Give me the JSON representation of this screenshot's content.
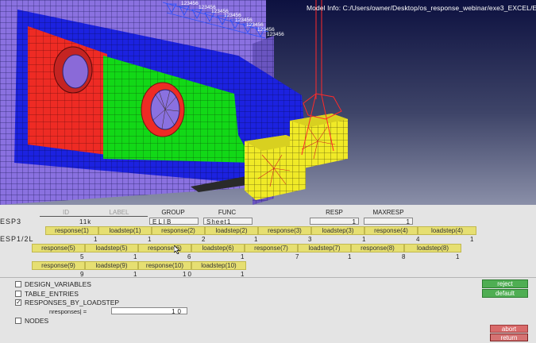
{
  "viewport": {
    "model_info": "Model Info: C:/Users/owner/Desktop/os_response_webinar/exe3_EXCEL/EXCEL.hm*",
    "load_label": "123456"
  },
  "card": {
    "title_row_label": "ESP3",
    "title_row2_label": "ESP1/2L",
    "headers": {
      "id": "ID",
      "label": "LABEL",
      "group": "GROUP",
      "func": "FUNC",
      "resp": "RESP",
      "maxresp": "MAXRESP"
    },
    "fields": {
      "id": "11k",
      "group": "ELIB",
      "func": "Sheet1",
      "resp": "1",
      "maxresp": "1"
    },
    "pairs": [
      {
        "resp_label": "response(1)",
        "resp_value": "1",
        "step_label": "loadstep(1)",
        "step_value": "1"
      },
      {
        "resp_label": "response(2)",
        "resp_value": "2",
        "step_label": "loadstep(2)",
        "step_value": "1"
      },
      {
        "resp_label": "response(3)",
        "resp_value": "3",
        "step_label": "loadstep(3)",
        "step_value": "1"
      },
      {
        "resp_label": "response(4)",
        "resp_value": "4",
        "step_label": "loadstep(4)",
        "step_value": "1"
      },
      {
        "resp_label": "response(5)",
        "resp_value": "5",
        "step_label": "loadstep(5)",
        "step_value": "1"
      },
      {
        "resp_label": "response(6)",
        "resp_value": "6",
        "step_label": "loadstep(6)",
        "step_value": "1"
      },
      {
        "resp_label": "response(7)",
        "resp_value": "7",
        "step_label": "loadstep(7)",
        "step_value": "1"
      },
      {
        "resp_label": "response(8)",
        "resp_value": "8",
        "step_label": "loadstep(8)",
        "step_value": "1"
      },
      {
        "resp_label": "response(9)",
        "resp_value": "9",
        "step_label": "loadstep(9)",
        "step_value": "1"
      },
      {
        "resp_label": "response(10)",
        "resp_value": "10",
        "step_label": "loadstep(10)",
        "step_value": "1"
      }
    ],
    "options": [
      {
        "label": "DESIGN_VARIABLES",
        "checked": false
      },
      {
        "label": "TABLE_ENTRIES",
        "checked": false
      },
      {
        "label": "RESPONSES_BY_LOADSTEP",
        "checked": true
      },
      {
        "label": "NODES",
        "checked": false
      }
    ],
    "nresponses_label": "nresponses| =",
    "nresponses_value": "10",
    "check_mark": "✓"
  },
  "buttons": {
    "reject": "reject",
    "default": "default",
    "abort": "abort",
    "return": "return"
  },
  "colors": {
    "viewport_bg_top": "#0d1140",
    "viewport_bg_bottom": "#8a8fa8",
    "mesh_purple": "#8a71e0",
    "mesh_red": "#ee2b24",
    "mesh_green": "#12d817",
    "mesh_blue": "#1c22e0",
    "mesh_yellow": "#f0ea27",
    "field_yellow": "#e6df72",
    "button_green": "#4fae53",
    "button_red": "#d96a6a"
  }
}
